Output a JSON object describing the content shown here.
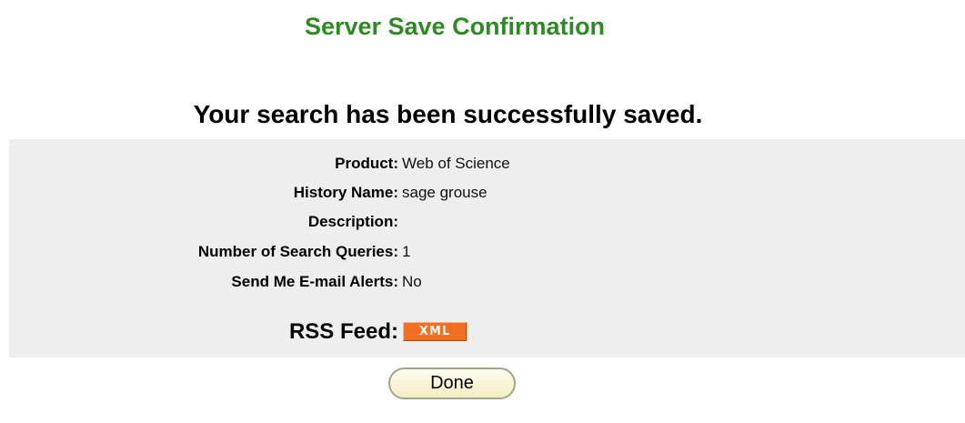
{
  "header": {
    "title": "Server Save Confirmation"
  },
  "message": {
    "text": "Your search has been successfully saved."
  },
  "details": [
    {
      "label": "Product:",
      "value": "Web of Science"
    },
    {
      "label": "History Name:",
      "value": "sage grouse"
    },
    {
      "label": "Description:",
      "value": ""
    },
    {
      "label": "Number of Search Queries:",
      "value": "1"
    },
    {
      "label": "Send Me E-mail Alerts:",
      "value": "No"
    }
  ],
  "rss": {
    "label": "RSS Feed:",
    "badge_text": "XML",
    "badge_color": "#f26f21"
  },
  "actions": {
    "done_label": "Done"
  },
  "colors": {
    "title": "#2e8b24",
    "panel_background": "#eeeeee"
  }
}
